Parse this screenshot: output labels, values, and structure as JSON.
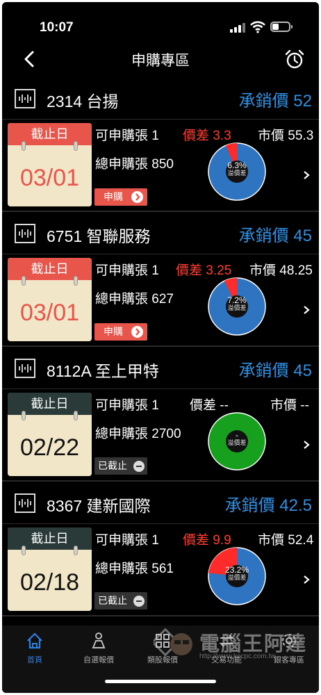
{
  "status": {
    "time": "10:07"
  },
  "nav": {
    "title": "申購專區",
    "back_icon": "chevron-left-icon",
    "alarm_icon": "alarm-clock-icon"
  },
  "colors": {
    "accent_blue": "#2f8fe0",
    "red": "#e7554b",
    "diff_red": "#ff3b30",
    "pie_blue": "#2f74c0",
    "pie_red": "#ff2a2a",
    "pie_green": "#16a01e"
  },
  "items": [
    {
      "name": "2314 台揚",
      "price_label": "承銷價 52",
      "deadline_label": "截止日",
      "date": "03/01",
      "qty": "可申購張 1",
      "diff": "價差 3.3",
      "market": "市價 55.3",
      "total": "總申購張 850",
      "button": "申購",
      "button_type": "buy",
      "pie_value": "6.3%",
      "pie_fraction": 0.063,
      "pie_sub": "溢價差",
      "pie_color": "blue"
    },
    {
      "name": "6751 智聯服務",
      "price_label": "承銷價 45",
      "deadline_label": "截止日",
      "date": "03/01",
      "qty": "可申購張 1",
      "diff": "價差 3.25",
      "market": "市價 48.25",
      "total": "總申購張 627",
      "button": "申購",
      "button_type": "buy",
      "pie_value": "7.2%",
      "pie_fraction": 0.072,
      "pie_sub": "溢價差",
      "pie_color": "blue"
    },
    {
      "name": "8112A 至上甲特",
      "price_label": "承銷價 45",
      "deadline_label": "截止日",
      "date": "02/22",
      "qty": "可申購張 1",
      "diff": "價差 --",
      "market": "市價 --",
      "total": "總申購張 2700",
      "button": "已截止",
      "button_type": "closed",
      "pie_value": "-",
      "pie_fraction": 0,
      "pie_sub": "溢價差",
      "pie_color": "green"
    },
    {
      "name": "8367 建新國際",
      "price_label": "承銷價 42.5",
      "deadline_label": "截止日",
      "date": "02/18",
      "qty": "可申購張 1",
      "diff": "價差 9.9",
      "market": "市價 52.4",
      "total": "總申購張 561",
      "button": "已截止",
      "button_type": "closed",
      "pie_value": "23.2%",
      "pie_fraction": 0.232,
      "pie_sub": "溢價差",
      "pie_color": "blue"
    }
  ],
  "tabs": [
    {
      "label": "首頁",
      "icon": "home-icon",
      "active": true
    },
    {
      "label": "自選報價",
      "icon": "person-chart-icon",
      "active": false
    },
    {
      "label": "類股報價",
      "icon": "grid-icon",
      "active": false
    },
    {
      "label": "交易功能",
      "icon": "trade-icon",
      "active": false
    },
    {
      "label": "銀客專區",
      "icon": "gear-icon",
      "active": false
    }
  ],
  "watermark": {
    "text": "電腦王阿達",
    "url": "http://www.kocpc.com.tw"
  }
}
